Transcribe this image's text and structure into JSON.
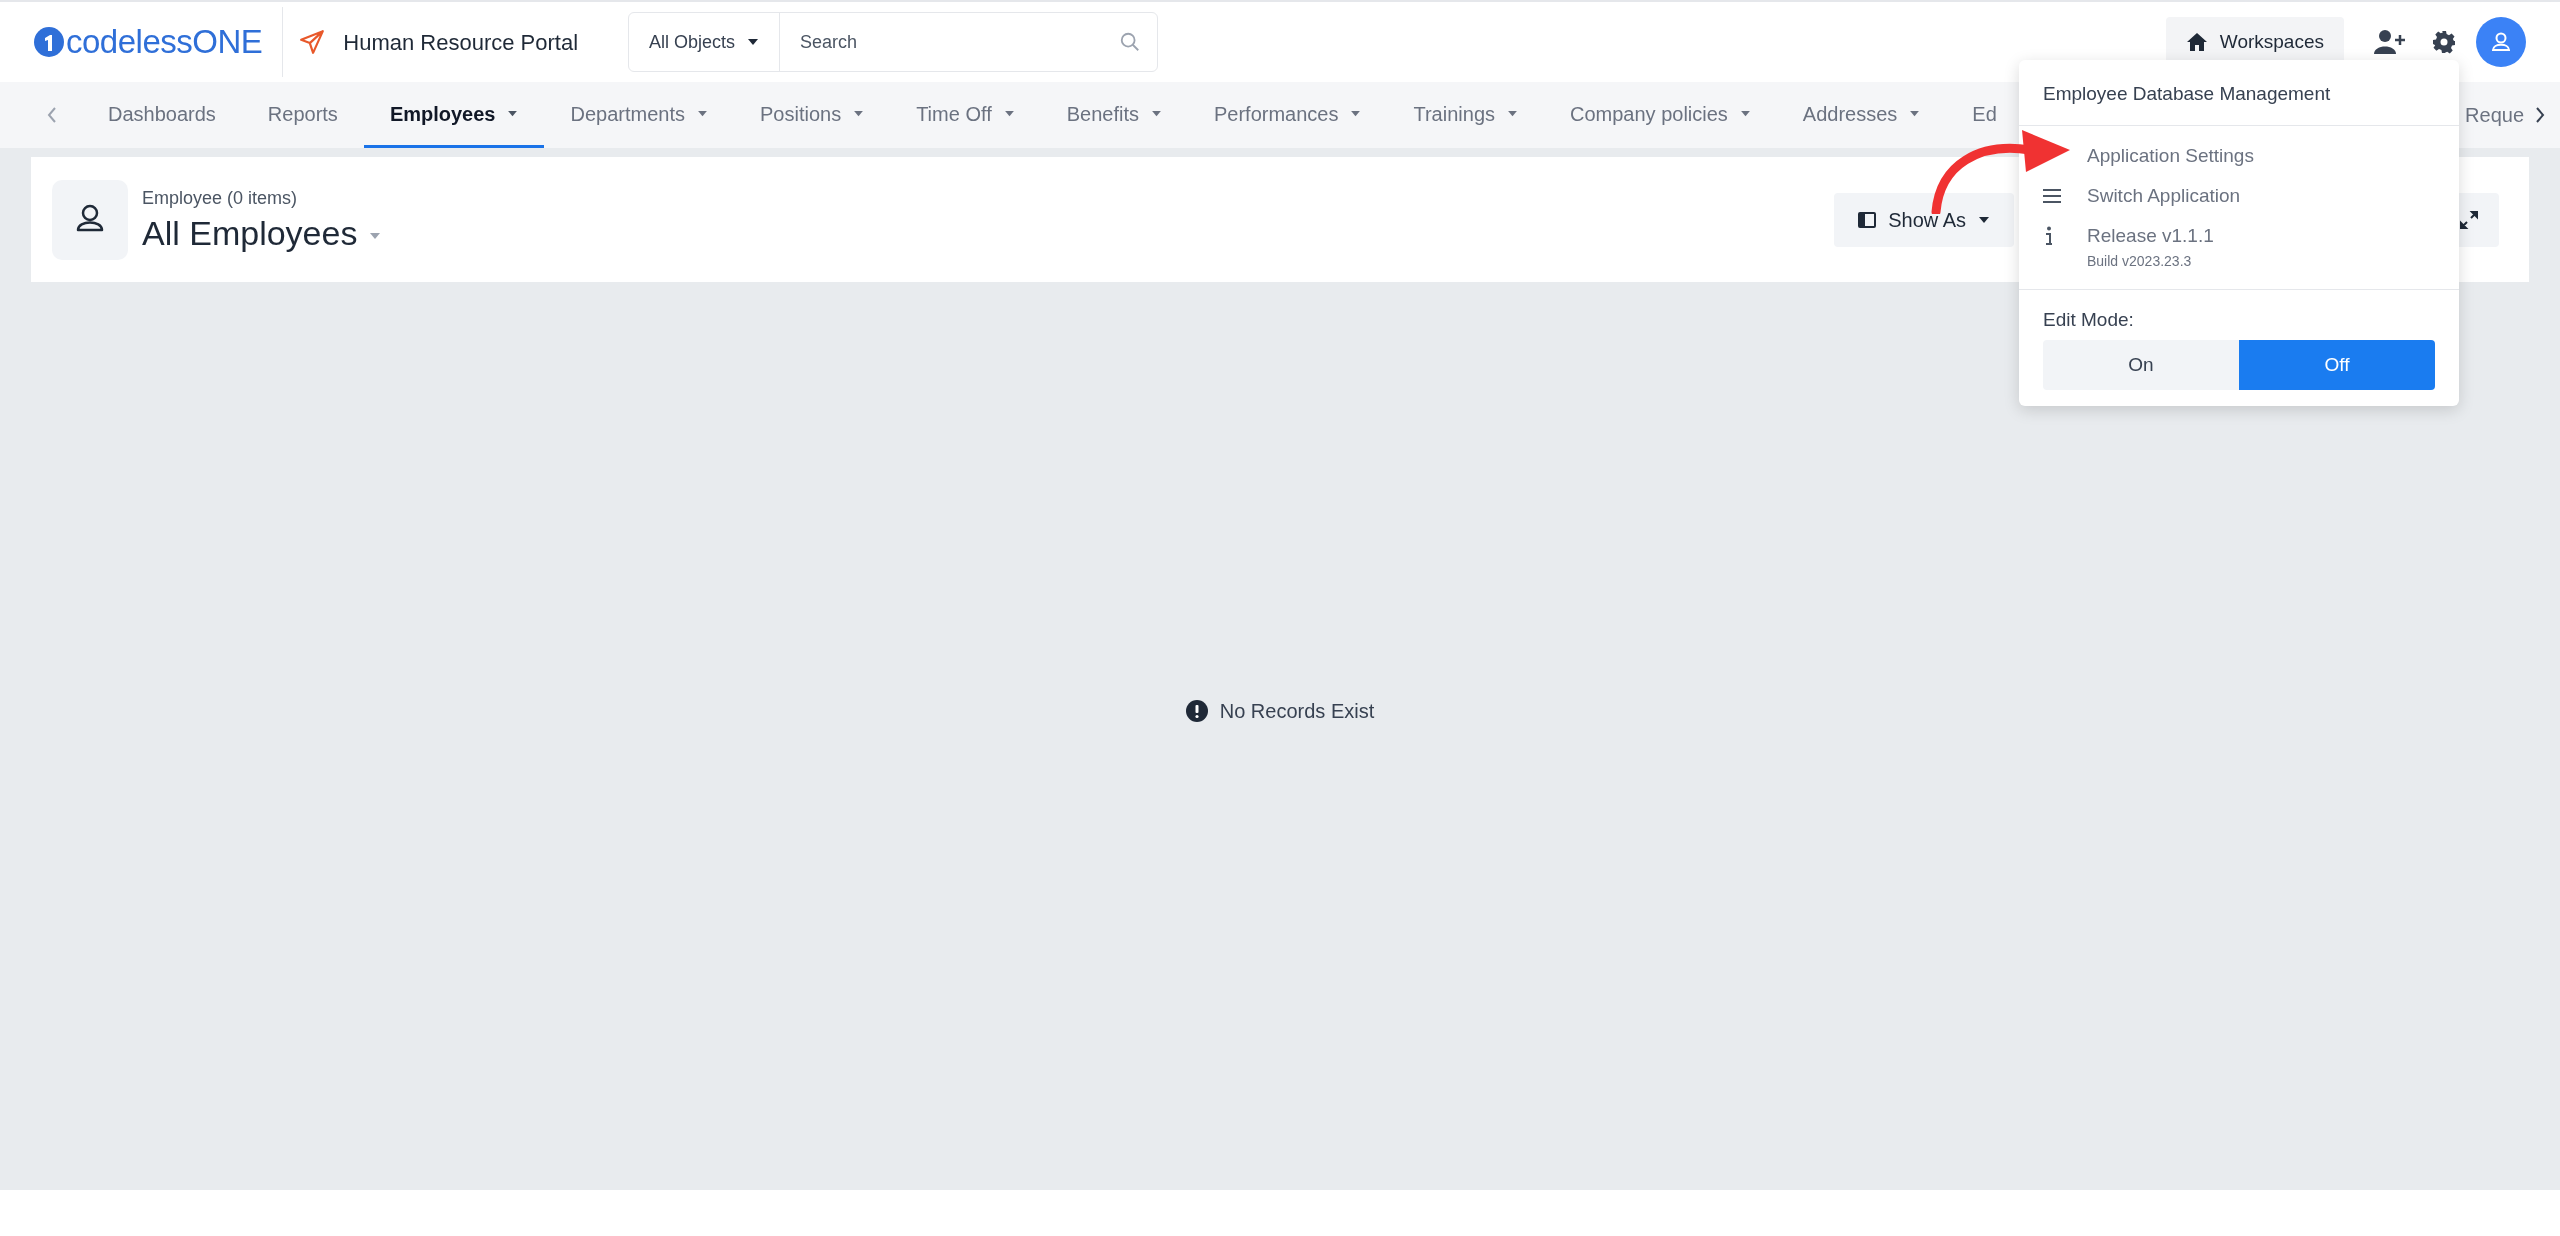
{
  "header": {
    "logo": "codelessONE",
    "app_title": "Human Resource Portal",
    "search": {
      "scope": "All Objects",
      "placeholder": "Search"
    },
    "workspaces": "Workspaces"
  },
  "nav": {
    "items": [
      {
        "label": "Dashboards",
        "selected": false,
        "caret": false
      },
      {
        "label": "Reports",
        "selected": false,
        "caret": false
      },
      {
        "label": "Employees",
        "selected": true,
        "caret": true
      },
      {
        "label": "Departments",
        "selected": false,
        "caret": true
      },
      {
        "label": "Positions",
        "selected": false,
        "caret": true
      },
      {
        "label": "Time Off",
        "selected": false,
        "caret": true
      },
      {
        "label": "Benefits",
        "selected": false,
        "caret": true
      },
      {
        "label": "Performances",
        "selected": false,
        "caret": true
      },
      {
        "label": "Trainings",
        "selected": false,
        "caret": true
      },
      {
        "label": "Company policies",
        "selected": false,
        "caret": true
      },
      {
        "label": "Addresses",
        "selected": false,
        "caret": true
      },
      {
        "label": "Ed",
        "selected": false,
        "caret": false
      }
    ],
    "trailing_item": "Reque"
  },
  "view": {
    "subtitle": "Employee (0 items)",
    "title": "All Employees",
    "show_as": "Show As"
  },
  "empty_message": "No Records Exist",
  "menu": {
    "title": "Employee Database Management",
    "items": [
      {
        "kind": "plain",
        "label": "Application Settings"
      },
      {
        "kind": "lines",
        "label": "Switch Application"
      },
      {
        "kind": "info",
        "label": "Release v1.1.1",
        "detail": "Build v2023.23.3"
      }
    ],
    "edit_mode": {
      "label": "Edit Mode:",
      "options": [
        {
          "label": "On",
          "selected": false
        },
        {
          "label": "Off",
          "selected": true
        }
      ]
    }
  }
}
